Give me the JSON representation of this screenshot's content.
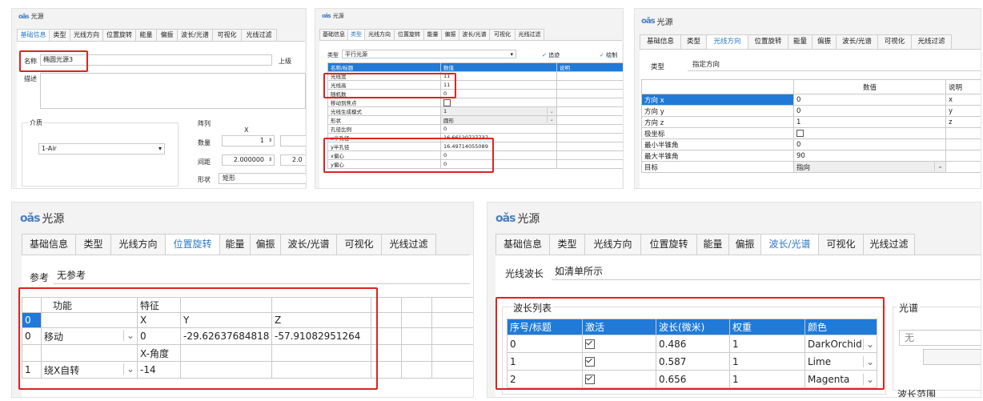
{
  "app_title": "光源",
  "logo": "oǎs",
  "tabs": [
    "基础信息",
    "类型",
    "光线方向",
    "位置旋转",
    "能量",
    "偏振",
    "波长/光谱",
    "可视化",
    "光线过滤"
  ],
  "p1": {
    "name_label": "名称",
    "name_value": "椭圆光源3",
    "parent_label": "上级",
    "desc_label": "描述",
    "medium_label": "介质",
    "medium_value": "1-Air",
    "array_label": "阵列",
    "x_label": "X",
    "count_label": "数量",
    "count_value": "1",
    "spacing_label": "间距",
    "spacing_value": "2.000000",
    "spacing_value2": "2.0",
    "shape_label": "形状",
    "shape_value": "矩形"
  },
  "p2": {
    "type_label": "类型",
    "type_value": "平行光源",
    "trace_label": "追迹",
    "draw_label": "绘制",
    "headers": [
      "名称/标题",
      "数值",
      "说明"
    ],
    "rows": [
      [
        "光线宽",
        "11"
      ],
      [
        "光线高",
        "11"
      ],
      [
        "随机数",
        "0"
      ],
      [
        "移动到焦点",
        ""
      ],
      [
        "光线生成模式",
        "1"
      ],
      [
        "形状",
        "圆形"
      ],
      [
        "孔径比例",
        "0"
      ],
      [
        "x半孔径",
        "16.66120727737"
      ],
      [
        "y半孔径",
        "16.49714055089"
      ],
      [
        "x偏心",
        "0"
      ],
      [
        "y偏心",
        "0"
      ]
    ]
  },
  "p3": {
    "type_label": "类型",
    "type_value": "指定方向",
    "headers": [
      "数值",
      "说明"
    ],
    "rows": [
      [
        "方向 x",
        "0",
        "x"
      ],
      [
        "方向 y",
        "0",
        "y"
      ],
      [
        "方向 z",
        "1",
        "z"
      ],
      [
        "极坐标",
        "",
        ""
      ],
      [
        "最小半锥角",
        "0",
        ""
      ],
      [
        "最大半锥角",
        "90",
        ""
      ],
      [
        "目标",
        "指向",
        ""
      ]
    ]
  },
  "p4": {
    "ref_label": "参考",
    "ref_value": "无参考",
    "col_func": "功能",
    "col_feat": "特征",
    "axis_x": "X",
    "axis_y": "Y",
    "axis_z": "Z",
    "sel_cell": "0",
    "row0_idx": "0",
    "row0_func": "移动",
    "row0_x": "0",
    "row0_y": "-29.62637684818",
    "row0_z": "-57.91082951264",
    "angle_label": "X-角度",
    "row1_idx": "1",
    "row1_func": "绕X自转",
    "row1_x": "-14"
  },
  "p5": {
    "wl_label": "光线波长",
    "wl_value": "如清单所示",
    "group_label": "波长列表",
    "spectrum_label": "光谱",
    "spectrum_value": "无",
    "range_label": "波长范围",
    "headers": [
      "序号/标题",
      "激活",
      "波长(微米)",
      "权重",
      "颜色"
    ],
    "rows": [
      [
        "0",
        "0.486",
        "1",
        "DarkOrchid"
      ],
      [
        "1",
        "0.587",
        "1",
        "Lime"
      ],
      [
        "2",
        "0.656",
        "1",
        "Magenta"
      ]
    ]
  }
}
